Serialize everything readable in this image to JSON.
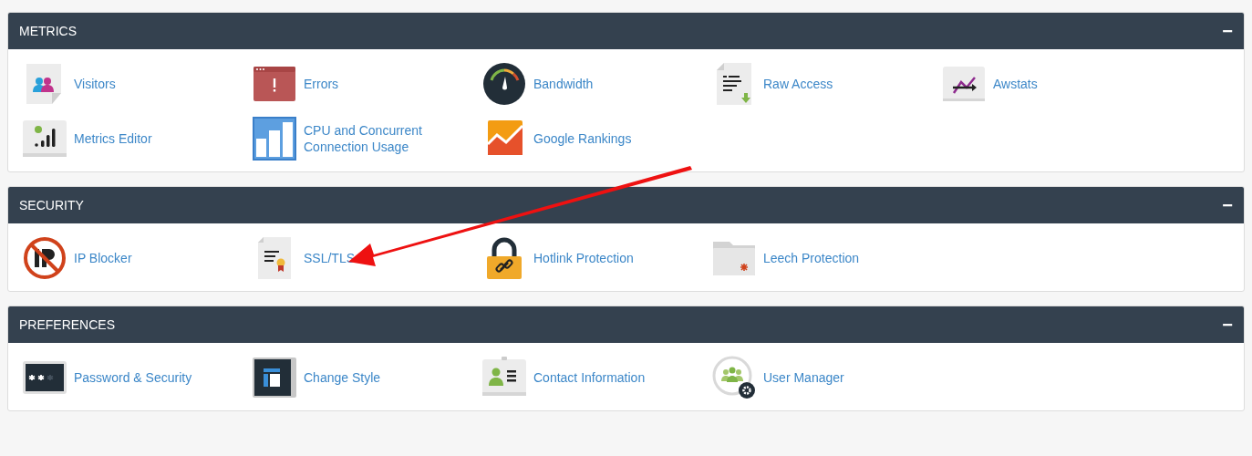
{
  "sections": [
    {
      "title": "METRICS",
      "collapse": "−",
      "items": [
        "Visitors",
        "Errors",
        "Bandwidth",
        "Raw Access",
        "Awstats",
        "Metrics Editor",
        "CPU and Concurrent Connection Usage",
        "Google Rankings"
      ]
    },
    {
      "title": "SECURITY",
      "collapse": "−",
      "items": [
        "IP Blocker",
        "SSL/TLS",
        "Hotlink Protection",
        "Leech Protection"
      ]
    },
    {
      "title": "PREFERENCES",
      "collapse": "−",
      "items": [
        "Password & Security",
        "Change Style",
        "Contact Information",
        "User Manager"
      ]
    }
  ]
}
